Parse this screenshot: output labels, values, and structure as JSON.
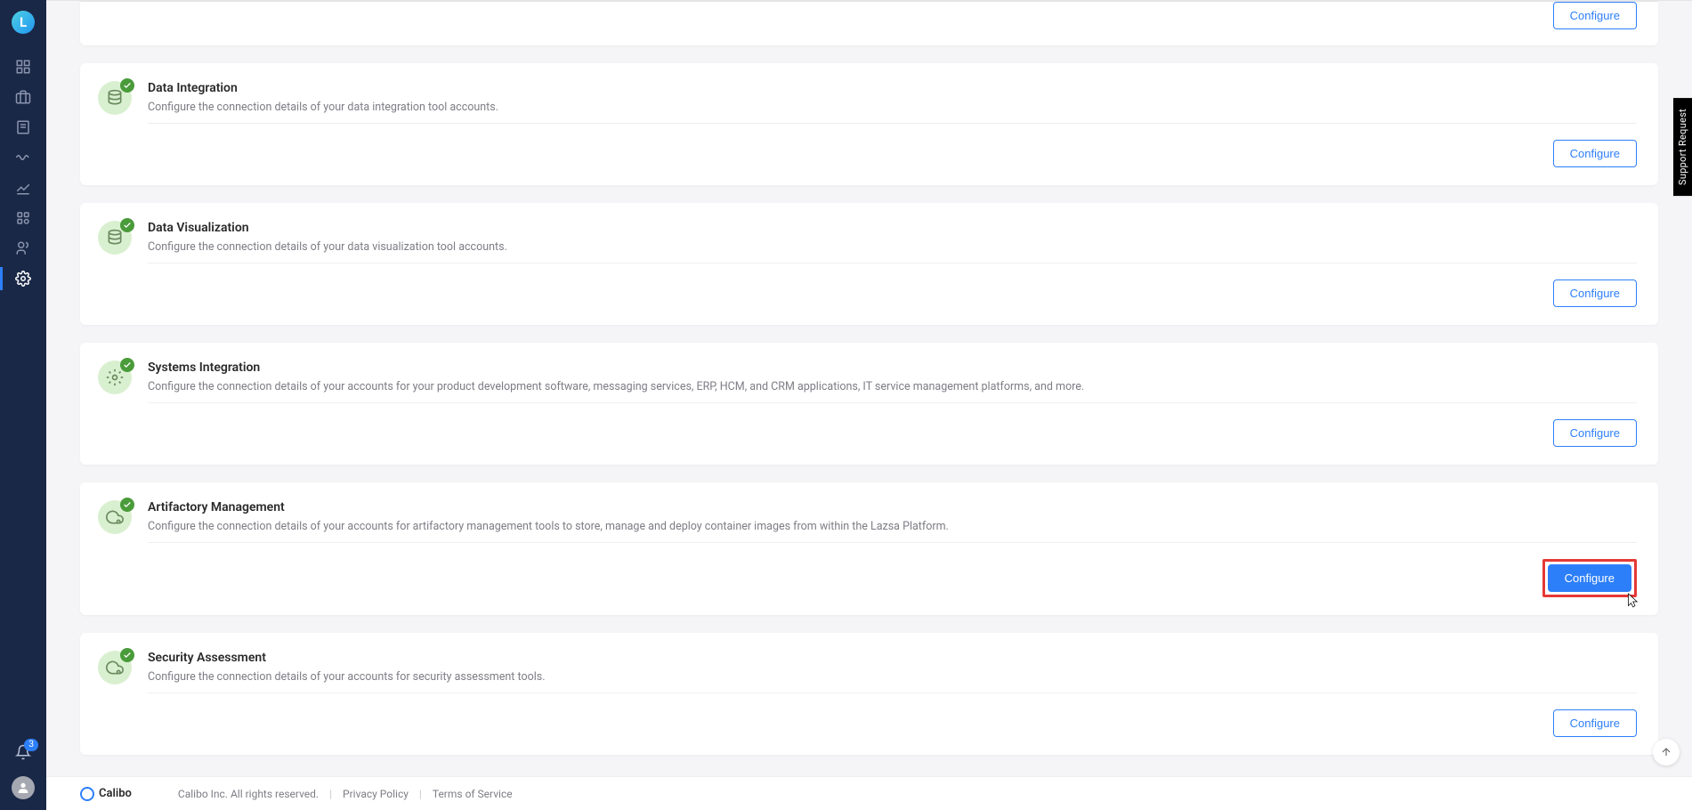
{
  "logo_letter": "L",
  "notifications_count": "3",
  "partial_card": {
    "button": "Configure"
  },
  "cards": [
    {
      "icon": "database",
      "title": "Data Integration",
      "desc": "Configure the connection details of your data integration tool accounts.",
      "button": "Configure",
      "highlighted": false
    },
    {
      "icon": "database",
      "title": "Data Visualization",
      "desc": "Configure the connection details of your data visualization tool accounts.",
      "button": "Configure",
      "highlighted": false
    },
    {
      "icon": "gear",
      "title": "Systems Integration",
      "desc": "Configure the connection details of your accounts for your product development software, messaging services, ERP, HCM, and CRM applications, IT service management platforms, and more.",
      "button": "Configure",
      "highlighted": false
    },
    {
      "icon": "cloud",
      "title": "Artifactory Management",
      "desc": "Configure the connection details of your accounts for artifactory management tools to store, manage and deploy container images from within the Lazsa Platform.",
      "button": "Configure",
      "highlighted": true
    },
    {
      "icon": "cloud",
      "title": "Security Assessment",
      "desc": "Configure the connection details of your accounts for security assessment tools.",
      "button": "Configure",
      "highlighted": false
    }
  ],
  "footer": {
    "brand": "Calibo",
    "copyright": "Calibo Inc. All rights reserved.",
    "privacy": "Privacy Policy",
    "terms": "Terms of Service"
  },
  "support_tab": "Support Request"
}
